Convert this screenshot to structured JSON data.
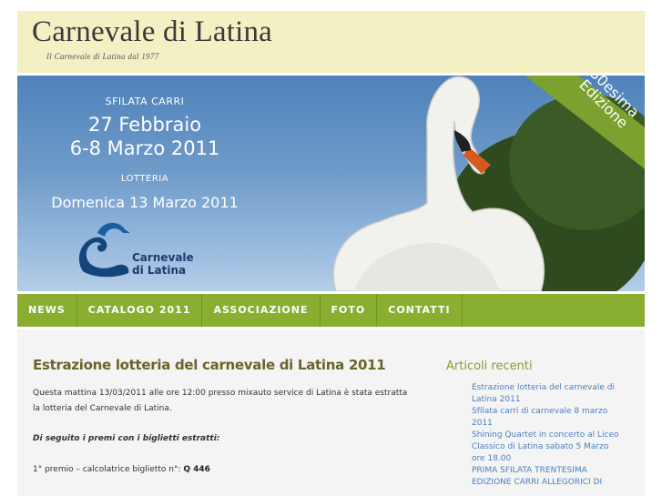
{
  "header": {
    "title": "Carnevale di Latina",
    "tagline": "Il Carnevale di Latina dal 1977"
  },
  "banner": {
    "sfilata_label": "SFILATA CARRI",
    "date_line1": "27 Febbraio",
    "date_line2": "6-8 Marzo 2011",
    "lotteria_label": "LOTTERIA",
    "lotteria_date": "Domenica 13 Marzo 2011",
    "logo_line1": "Carnevale",
    "logo_line2": "di Latina",
    "ribbon_line1": "30esima",
    "ribbon_line2": "Edizione"
  },
  "nav": {
    "items": [
      "NEWS",
      "CATALOGO 2011",
      "ASSOCIAZIONE",
      "FOTO",
      "CONTATTI"
    ]
  },
  "post": {
    "title": "Estrazione lotteria del carnevale di Latina 2011",
    "paragraph1": "Questa mattina 13/03/2011 alle ore 12:00 presso mixauto service di Latina è stata estratta la lotteria del Carnevale di Latina.",
    "paragraph2": "Di seguito i premi con i biglietti estratti:",
    "prize1_text": "1° premio – calcolatrice biglietto n°: ",
    "prize1_ticket": "Q 446"
  },
  "sidebar": {
    "title": "Articoli recenti",
    "items": [
      "Estrazione lotteria del carnevale di Latina 2011",
      "Sfilata carri di carnevale 8 marzo 2011",
      "Shining Quartet in concerto al Liceo Classico di Latina sabato 5 Marzo ore 18.00",
      "PRIMA SFILATA TRENTESIMA EDIZIONE CARRI ALLEGORICI DI"
    ]
  },
  "colors": {
    "header_bg": "#f3f0c3",
    "nav_bg": "#8aae2f",
    "post_title": "#6a6428",
    "sidebar_title": "#7fa02e",
    "link": "#4b7fc0"
  }
}
